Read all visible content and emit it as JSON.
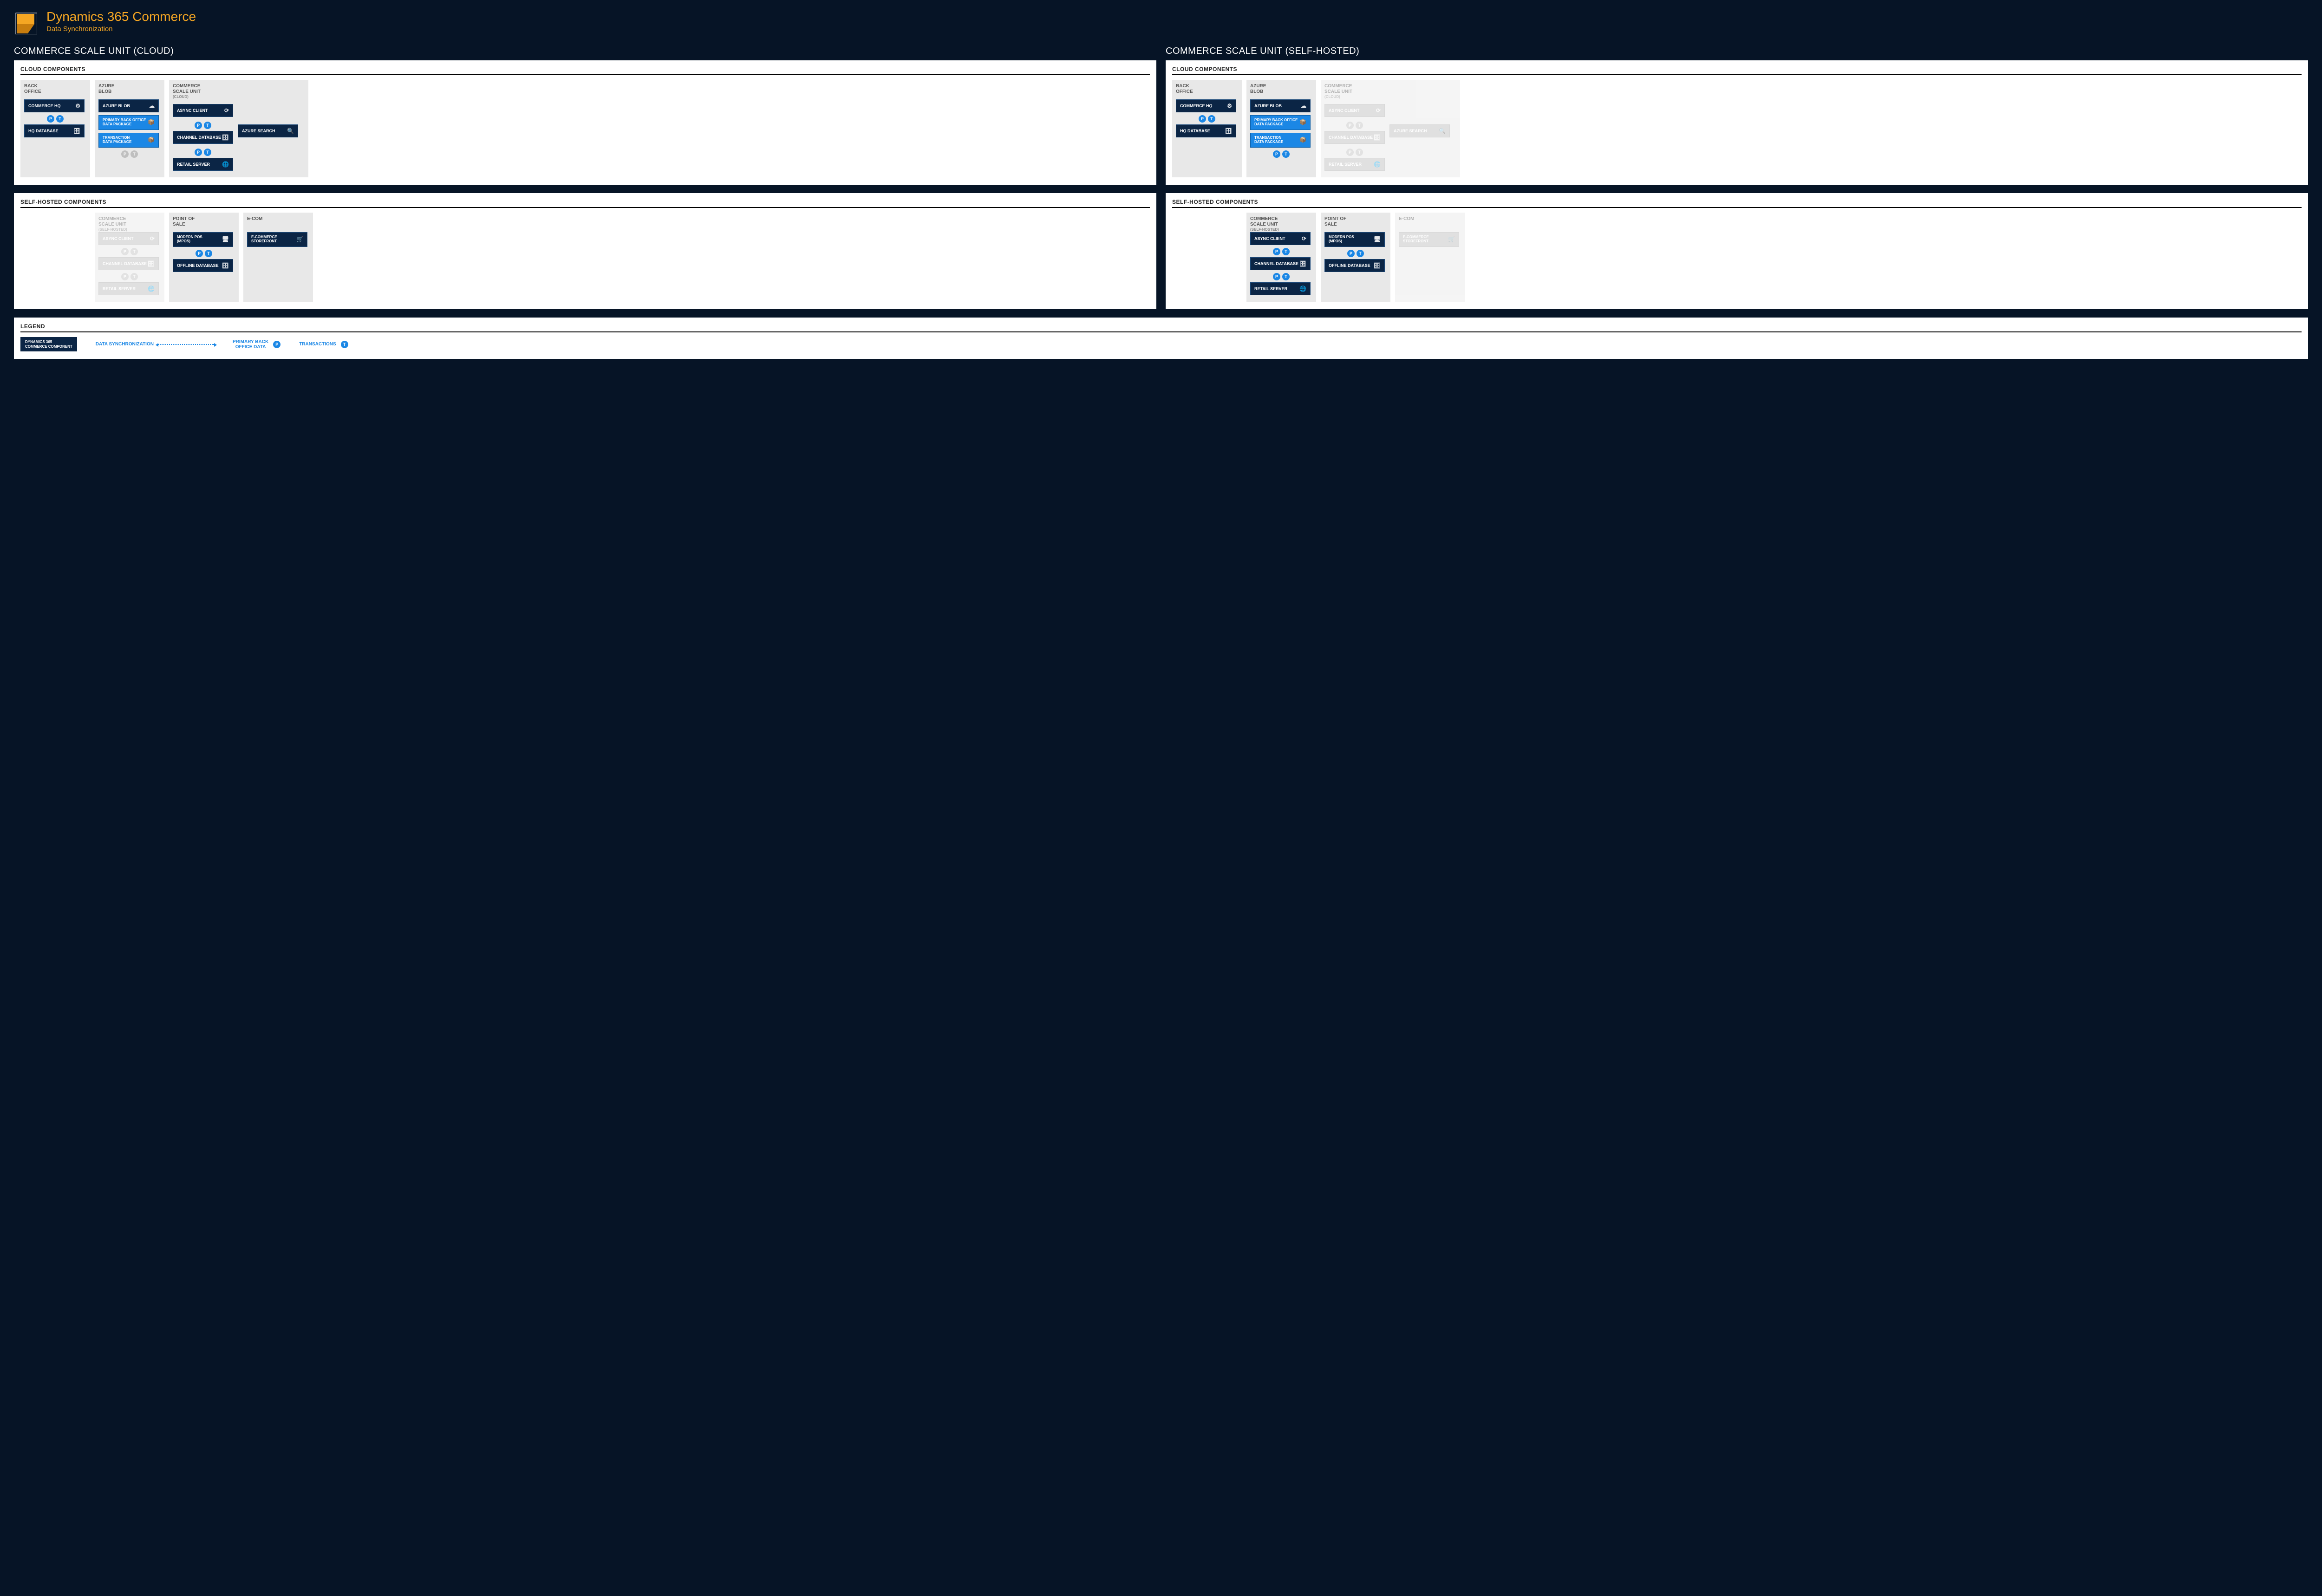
{
  "header": {
    "title": "Dynamics 365 Commerce",
    "subtitle": "Data Synchronization"
  },
  "sections": {
    "cloud": "COMMERCE SCALE UNIT (CLOUD)",
    "self": "COMMERCE SCALE UNIT (SELF-HOSTED)"
  },
  "panels": {
    "cloud": "CLOUD COMPONENTS",
    "self": "SELF-HOSTED COMPONENTS",
    "legend": "LEGEND"
  },
  "zones": {
    "backoffice": "BACK\nOFFICE",
    "azureblob": "AZURE\nBLOB",
    "csu_cloud": "COMMERCE\nSCALE UNIT",
    "csu_cloud_sub": "(CLOUD)",
    "csu_self": "COMMERCE\nSCALE UNIT",
    "csu_self_sub": "(SELF-HOSTED)",
    "pos": "POINT OF\nSALE",
    "ecom": "E-COM"
  },
  "components": {
    "commerce_hq": "COMMERCE HQ",
    "hq_database": "HQ DATABASE",
    "azure_blob": "AZURE BLOB",
    "primary_pkg": "PRIMARY BACK OFFICE\nDATA PACKAGE",
    "txn_pkg": "TRANSACTION\nDATA PACKAGE",
    "async_client": "ASYNC CLIENT",
    "channel_db": "CHANNEL DATABASE",
    "retail_server": "RETAIL SERVER",
    "azure_search": "AZURE SEARCH",
    "modern_pos": "MODERN POS\n(MPOS)",
    "offline_db": "OFFLINE DATABASE",
    "storefront": "E-COMMERCE\nSTOREFRONT"
  },
  "badges": {
    "p": "P",
    "t": "T"
  },
  "legend": {
    "component": "DYNAMICS 365\nCOMMERCE COMPONENT",
    "data_sync": "DATA SYNCHRONIZATION",
    "primary": "PRIMARY BACK\nOFFICE DATA",
    "txn": "TRANSACTIONS"
  },
  "icons": {
    "gear": "⚙",
    "db": "🗄",
    "cloud": "☁",
    "box": "📦",
    "sync": "⟳",
    "globe": "🌐",
    "search": "🔍",
    "pos": "🖥",
    "store": "🛒"
  }
}
